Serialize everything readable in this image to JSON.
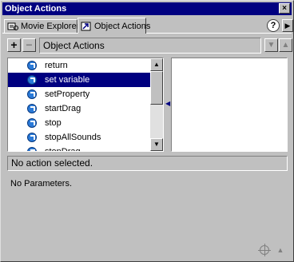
{
  "window": {
    "title": "Object Actions",
    "close_glyph": "×"
  },
  "tabs": [
    {
      "label": "Movie Explorer",
      "icon": "movie-explorer-icon",
      "active": false
    },
    {
      "label": "Object Actions",
      "icon": "object-actions-icon",
      "active": true
    }
  ],
  "header_icons": {
    "help": "?",
    "menu": "▶"
  },
  "toolbar": {
    "add_glyph": "+",
    "remove_glyph": "−",
    "field_value": "Object Actions",
    "move_down_glyph": "▼",
    "move_up_glyph": "▲"
  },
  "actions_list": {
    "items": [
      {
        "label": "return"
      },
      {
        "label": "set variable",
        "selected": true
      },
      {
        "label": "setProperty"
      },
      {
        "label": "startDrag"
      },
      {
        "label": "stop"
      },
      {
        "label": "stopAllSounds"
      },
      {
        "label": "stopDrag"
      }
    ],
    "scroll_up_glyph": "▲",
    "scroll_down_glyph": "▼"
  },
  "splitter_glyph": "◀",
  "status": {
    "message": "No action selected."
  },
  "params": {
    "message": "No Parameters."
  },
  "colors": {
    "selection": "#000080",
    "title_bar": "#000080",
    "icon_blue": "#2a7ad8"
  }
}
